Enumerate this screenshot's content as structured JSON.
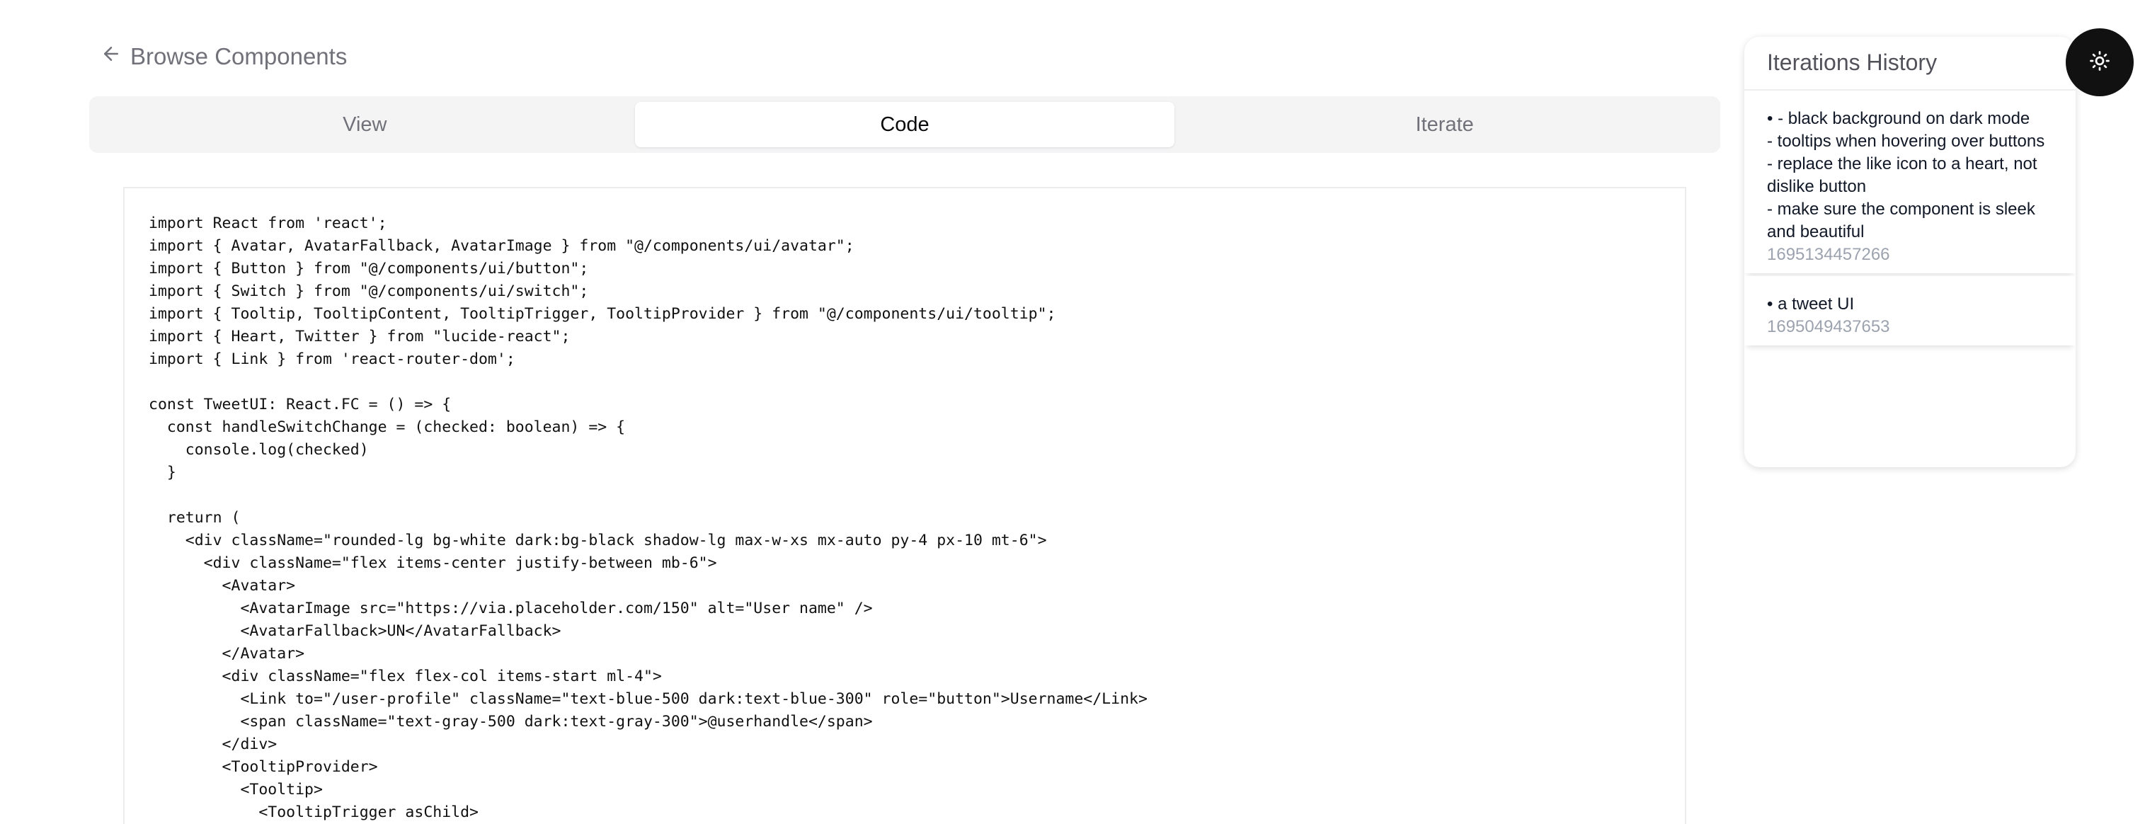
{
  "nav": {
    "back_label": "Browse Components",
    "back_icon": "arrow-left-icon"
  },
  "tabs": [
    {
      "label": "View",
      "active": false
    },
    {
      "label": "Code",
      "active": true
    },
    {
      "label": "Iterate",
      "active": false
    }
  ],
  "code": {
    "lines": [
      "import React from 'react';",
      "import { Avatar, AvatarFallback, AvatarImage } from \"@/components/ui/avatar\";",
      "import { Button } from \"@/components/ui/button\";",
      "import { Switch } from \"@/components/ui/switch\";",
      "import { Tooltip, TooltipContent, TooltipTrigger, TooltipProvider } from \"@/components/ui/tooltip\";",
      "import { Heart, Twitter } from \"lucide-react\";",
      "import { Link } from 'react-router-dom';",
      "",
      "const TweetUI: React.FC = () => {",
      "  const handleSwitchChange = (checked: boolean) => {",
      "    console.log(checked)",
      "  }",
      "",
      "  return (",
      "    <div className=\"rounded-lg bg-white dark:bg-black shadow-lg max-w-xs mx-auto py-4 px-10 mt-6\">",
      "      <div className=\"flex items-center justify-between mb-6\">",
      "        <Avatar>",
      "          <AvatarImage src=\"https://via.placeholder.com/150\" alt=\"User name\" />",
      "          <AvatarFallback>UN</AvatarFallback>",
      "        </Avatar>",
      "        <div className=\"flex flex-col items-start ml-4\">",
      "          <Link to=\"/user-profile\" className=\"text-blue-500 dark:text-blue-300\" role=\"button\">Username</Link>",
      "          <span className=\"text-gray-500 dark:text-gray-300\">@userhandle</span>",
      "        </div>",
      "        <TooltipProvider>",
      "          <Tooltip>",
      "            <TooltipTrigger asChild>"
    ]
  },
  "history": {
    "title": "Iterations History",
    "items": [
      {
        "text": "• - black background on dark mode\n- tooltips when hovering over buttons\n- replace the like icon to a heart, not dislike button\n- make sure the component is sleek and beautiful",
        "timestamp": "1695134457266"
      },
      {
        "text": "• a tweet UI",
        "timestamp": "1695049437653"
      }
    ]
  },
  "theme_toggle": {
    "icon": "sun-icon",
    "background": "#111111"
  }
}
